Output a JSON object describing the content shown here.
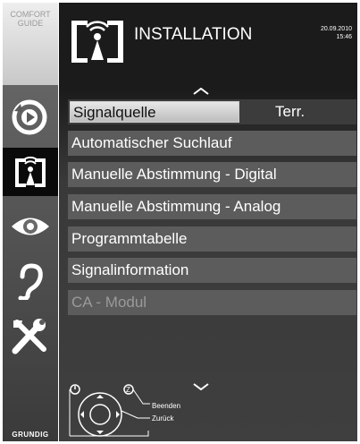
{
  "sidebar": {
    "comfort_label": "COMFORT GUIDE",
    "brand": "GRUNDIG",
    "items": [
      {
        "icon": "source-icon"
      },
      {
        "icon": "installation-antenna-icon",
        "active": true
      },
      {
        "icon": "picture-eye-icon"
      },
      {
        "icon": "sound-ear-icon"
      },
      {
        "icon": "settings-tools-icon"
      }
    ]
  },
  "header": {
    "title": "INSTALLATION",
    "date": "20.09.2010",
    "time": "15:46"
  },
  "menu": {
    "items": [
      {
        "label": "Signalquelle",
        "value": "Terr.",
        "selected": true
      },
      {
        "label": "Automatischer Suchlauf"
      },
      {
        "label": "Manuelle Abstimmung - Digital"
      },
      {
        "label": "Manuelle Abstimmung - Analog"
      },
      {
        "label": "Programmtabelle"
      },
      {
        "label": "Signalinformation"
      },
      {
        "label": "CA - Modul",
        "disabled": true
      }
    ]
  },
  "footer": {
    "exit_label": "Beenden",
    "back_label": "Zurück"
  },
  "colors": {
    "menu_item_bg": "#5c5c5c",
    "selected_bg": "#d8d8d8",
    "panel_bg": "#1b1b1b",
    "disabled_text": "#9a9a9a"
  }
}
